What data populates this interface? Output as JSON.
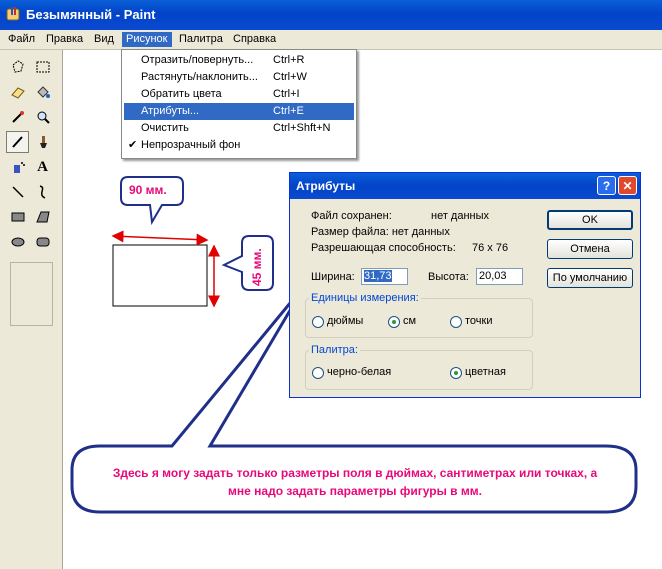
{
  "window": {
    "title": "Безымянный - Paint"
  },
  "menubar": {
    "items": [
      "Файл",
      "Правка",
      "Вид",
      "Рисунок",
      "Палитра",
      "Справка"
    ]
  },
  "dropdown": {
    "items": [
      {
        "label": "Отразить/повернуть...",
        "shortcut": "Ctrl+R"
      },
      {
        "label": "Растянуть/наклонить...",
        "shortcut": "Ctrl+W"
      },
      {
        "label": "Обратить цвета",
        "shortcut": "Ctrl+I"
      },
      {
        "label": "Атрибуты...",
        "shortcut": "Ctrl+E"
      },
      {
        "label": "Очистить",
        "shortcut": "Ctrl+Shft+N"
      },
      {
        "label": "Непрозрачный фон",
        "shortcut": ""
      }
    ]
  },
  "tools": [
    "free-select-icon",
    "rect-select-icon",
    "eraser-icon",
    "fill-icon",
    "picker-icon",
    "magnifier-icon",
    "pencil-icon",
    "brush-icon",
    "airbrush-icon",
    "text-icon",
    "line-icon",
    "curve-icon",
    "rectangle-icon",
    "polygon-icon",
    "ellipse-icon",
    "rounded-rect-icon"
  ],
  "dialog": {
    "title": "Атрибуты",
    "help": "?",
    "close": "✕",
    "file_saved_label": "Файл сохранен:",
    "file_saved_value": "нет данных",
    "file_size": "Размер файла: нет данных",
    "resolution_label": "Разрешающая способность:",
    "resolution_value": "76 x 76",
    "width_label": "Ширина:",
    "width_value": "31,73",
    "height_label": "Высота:",
    "height_value": "20,03",
    "units_title": "Единицы измерения:",
    "units": [
      "дюймы",
      "см",
      "точки"
    ],
    "units_selected": "см",
    "palette_title": "Палитра:",
    "palette": [
      "черно-белая",
      "цветная"
    ],
    "palette_selected": "цветная",
    "ok": "OK",
    "cancel": "Отмена",
    "default": "По умолчанию"
  },
  "annotations": {
    "width_mm": "90 мм.",
    "height_mm": "45 мм.",
    "comment": "Здесь я могу задать только разметры поля в дюймах, сантиметрах или точках, а мне надо задать параметры фигуры в мм."
  },
  "colors": {
    "accent": "#316ac5",
    "callout_text": "#e8087a",
    "callout_border": "#1f2f8a",
    "arrow": "#e00000"
  }
}
